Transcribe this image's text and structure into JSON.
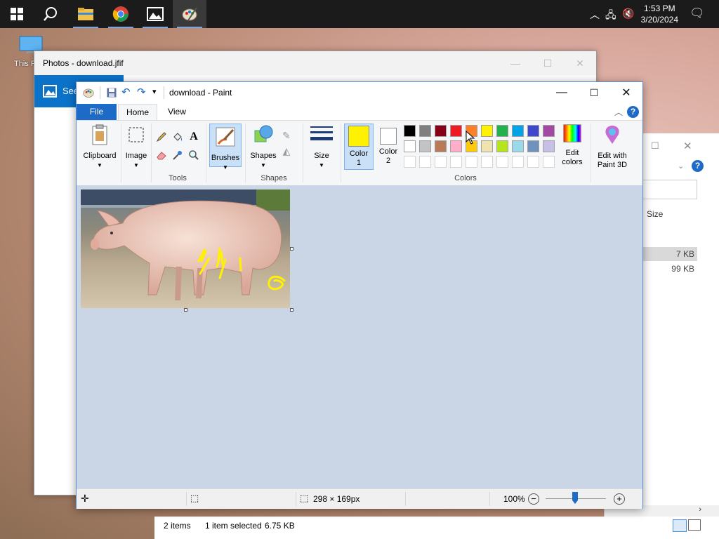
{
  "taskbar": {
    "time": "1:53 PM",
    "date": "3/20/2024",
    "apps": [
      "windows-start",
      "search",
      "file-explorer",
      "chrome",
      "photos",
      "paint"
    ]
  },
  "desktop": {
    "icon_label": "This P"
  },
  "photos_window": {
    "title": "Photos - download.jfif",
    "banner_text": "See"
  },
  "explorer_window": {
    "column_size": "Size",
    "file_sizes": [
      "7 KB",
      "99 KB"
    ],
    "status_items": "2 items",
    "status_selected": "1 item selected",
    "status_size": "6.75 KB"
  },
  "paint": {
    "title": "download - Paint",
    "tabs": {
      "file": "File",
      "home": "Home",
      "view": "View"
    },
    "groups": {
      "clipboard": "Clipboard",
      "image": "Image",
      "tools": "Tools",
      "brushes": "Brushes",
      "shapes_btn": "Shapes",
      "shapes_group": "Shapes",
      "size": "Size",
      "color1": "Color 1",
      "color2": "Color 2",
      "colors_group": "Colors",
      "edit_colors": "Edit colors",
      "edit_3d": "Edit with Paint 3D"
    },
    "palette_row1": [
      "#000000",
      "#7f7f7f",
      "#880015",
      "#ed1c24",
      "#ff7f27",
      "#fff200",
      "#22b14c",
      "#00a2e8",
      "#3f48cc",
      "#a349a4"
    ],
    "palette_row2": [
      "#ffffff",
      "#c3c3c3",
      "#b97a57",
      "#ffaec9",
      "#ffc90e",
      "#efe4b0",
      "#b5e61d",
      "#99d9ea",
      "#7092be",
      "#c8bfe7"
    ],
    "color1_value": "#fff200",
    "color2_value": "#ffffff",
    "accent": "#1d6ac7",
    "status": {
      "dimensions": "298 × 169px",
      "zoom": "100%"
    }
  }
}
